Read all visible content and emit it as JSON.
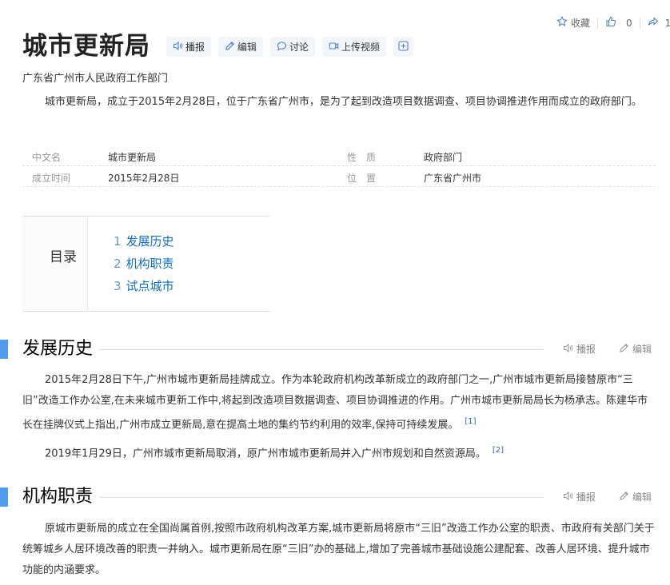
{
  "top_actions": {
    "collect_label": "收藏",
    "like_count": "0",
    "share_count": "1"
  },
  "title": "城市更新局",
  "title_buttons": {
    "play": "播报",
    "edit": "编辑",
    "discuss": "讨论",
    "upload_video": "上传视频"
  },
  "subtitle": "广东省广州市人民政府工作部门",
  "summary": "城市更新局，成立于2015年2月28日，位于广东省广州市，是为了起到改造项目数据调查、项目协调推进作用而成立的政府部门。",
  "basic_info": {
    "row1": {
      "label1": "中文名",
      "value1": "城市更新局",
      "label2": "性　质",
      "value2": "政府部门"
    },
    "row2": {
      "label1": "成立时间",
      "value1": "2015年2月28日",
      "label2": "位　置",
      "value2": "广东省广州市"
    }
  },
  "toc": {
    "title": "目录",
    "items": [
      {
        "num": "1",
        "label": "发展历史"
      },
      {
        "num": "2",
        "label": "机构职责"
      },
      {
        "num": "3",
        "label": "试点城市"
      }
    ]
  },
  "sections": {
    "history": {
      "heading": "发展历史",
      "play": "播报",
      "edit": "编辑",
      "p1": "2015年2月28日下午,广州市城市更新局挂牌成立。作为本轮政府机构改革新成立的政府部门之一,广州市城市更新局接替原市“三旧”改造工作办公室,在未来城市更新工作中,将起到改造项目数据调查、项目协调推进的作用。广州市城市更新局局长为杨承志。陈建华市长在挂牌仪式上指出,广州市成立更新局,意在提高土地的集约节约利用的效率,保持可持续发展。",
      "p1_ref": "[1]",
      "p2": "2019年1月29日，广州市城市更新局取消，原广州市城市更新局并入广州市规划和自然资源局。",
      "p2_ref": "[2]"
    },
    "duty": {
      "heading": "机构职责",
      "play": "播报",
      "edit": "编辑",
      "p1": "原城市更新局的成立在全国尚属首例,按照市政府机构改革方案,城市更新局将原市“三旧”改造工作办公室的职责、市政府有关部门关于统筹城乡人居环境改善的职责一并纳入。城市更新局在原“三旧”办的基础上,增加了完善城市基础设施公建配套、改善人居环境、提升城市功能的内涵要求。"
    }
  }
}
